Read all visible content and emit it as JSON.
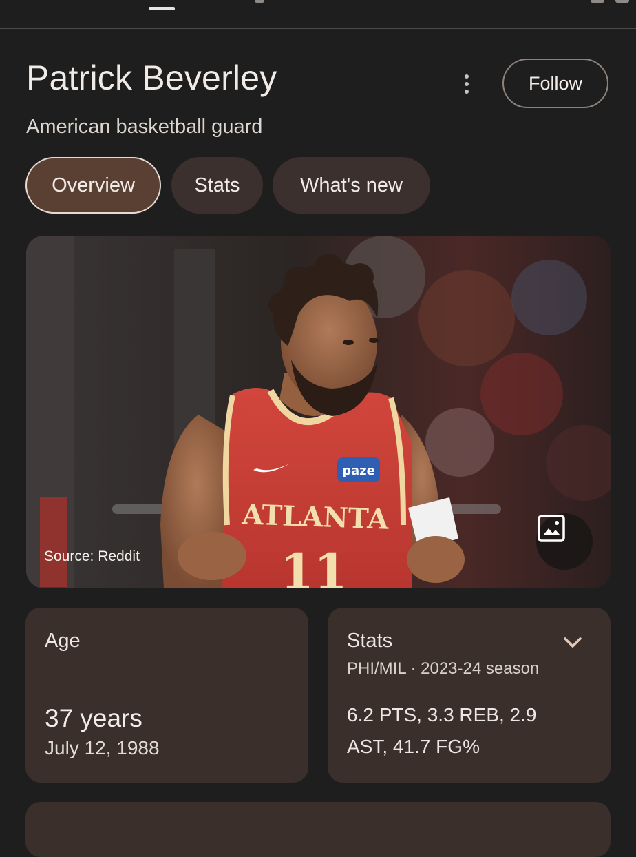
{
  "header": {
    "title": "Patrick Beverley",
    "subtitle": "American basketball guard",
    "follow_label": "Follow",
    "more_icon": "more-vert-icon"
  },
  "tabs": [
    {
      "label": "Overview",
      "active": true
    },
    {
      "label": "Stats",
      "active": false
    },
    {
      "label": "What's new",
      "active": false
    }
  ],
  "photo": {
    "source_label": "Source: Reddit",
    "jersey_text": "ATLANTA",
    "jersey_number": "11",
    "sponsor": "paze",
    "image_button_icon": "image-icon"
  },
  "cards": {
    "age": {
      "heading": "Age",
      "value": "37 years",
      "birth_date": "July 12, 1988"
    },
    "stats": {
      "heading": "Stats",
      "subtitle": "PHI/MIL · 2023-24 season",
      "line1": "6.2 PTS, 3.3 REB, 2.9",
      "line2": "AST, 41.7 FG%",
      "expand_icon": "chevron-down-icon"
    }
  },
  "colors": {
    "background": "#1f1e1e",
    "chip_active": "#5a3f33",
    "chip": "#3b302d",
    "card": "#3a2f2b",
    "jersey_red": "#c8423a",
    "jersey_trim": "#f0d6a0"
  }
}
